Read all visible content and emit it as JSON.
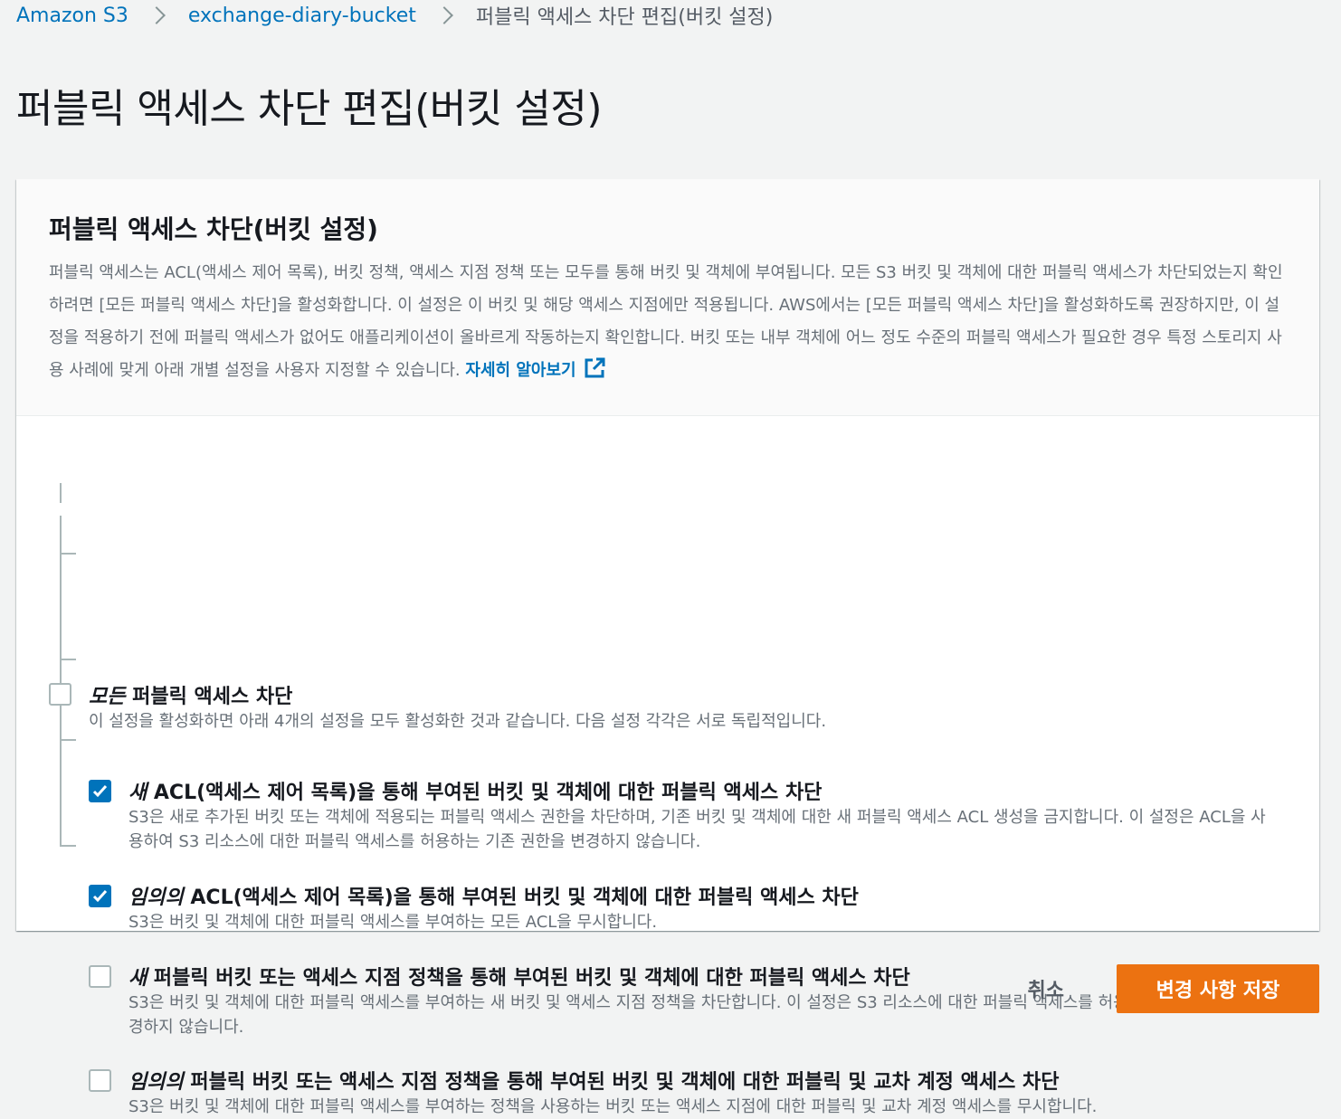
{
  "breadcrumb": {
    "items": [
      "Amazon S3",
      "exchange-diary-bucket"
    ],
    "current": "퍼블릭 액세스 차단 편집(버킷 설정)"
  },
  "page_title": "퍼블릭 액세스 차단 편집(버킷 설정)",
  "panel": {
    "title": "퍼블릭 액세스 차단(버킷 설정)",
    "description": "퍼블릭 액세스는 ACL(액세스 제어 목록), 버킷 정책, 액세스 지점 정책 또는 모두를 통해 버킷 및 객체에 부여됩니다. 모든 S3 버킷 및 객체에 대한 퍼블릭 액세스가 차단되었는지 확인하려면 [모든 퍼블릭 액세스 차단]을 활성화합니다. 이 설정은 이 버킷 및 해당 액세스 지점에만 적용됩니다. AWS에서는 [모든 퍼블릭 액세스 차단]을 활성화하도록 권장하지만, 이 설정을 적용하기 전에 퍼블릭 액세스가 없어도 애플리케이션이 올바르게 작동하는지 확인합니다. 버킷 또는 내부 객체에 어느 정도 수준의 퍼블릭 액세스가 필요한 경우 특정 스토리지 사용 사례에 맞게 아래 개별 설정을 사용자 지정할 수 있습니다.",
    "learn_more": "자세히 알아보기",
    "learn_more_icon": "external-link-icon"
  },
  "options": {
    "all": {
      "emph": "모든",
      "label": " 퍼블릭 액세스 차단",
      "desc": "이 설정을 활성화하면 아래 4개의 설정을 모두 활성화한 것과 같습니다. 다음 설정 각각은 서로 독립적입니다.",
      "checked": false
    },
    "new_acl": {
      "emph": "새",
      "label": " ACL(액세스 제어 목록)을 통해 부여된 버킷 및 객체에 대한 퍼블릭 액세스 차단",
      "desc": "S3은 새로 추가된 버킷 또는 객체에 적용되는 퍼블릭 액세스 권한을 차단하며, 기존 버킷 및 객체에 대한 새 퍼블릭 액세스 ACL 생성을 금지합니다. 이 설정은 ACL을 사용하여 S3 리소스에 대한 퍼블릭 액세스를 허용하는 기존 권한을 변경하지 않습니다.",
      "checked": true
    },
    "any_acl": {
      "emph": "임의의",
      "label": " ACL(액세스 제어 목록)을 통해 부여된 버킷 및 객체에 대한 퍼블릭 액세스 차단",
      "desc": "S3은 버킷 및 객체에 대한 퍼블릭 액세스를 부여하는 모든 ACL을 무시합니다.",
      "checked": true
    },
    "new_policy": {
      "emph": "새",
      "label": " 퍼블릭 버킷 또는 액세스 지점 정책을 통해 부여된 버킷 및 객체에 대한 퍼블릭 액세스 차단",
      "desc": "S3은 버킷 및 객체에 대한 퍼블릭 액세스를 부여하는 새 버킷 및 액세스 지점 정책을 차단합니다. 이 설정은 S3 리소스에 대한 퍼블릭 액세스를 허용하는 기존 정책을 변경하지 않습니다.",
      "checked": false
    },
    "any_policy": {
      "emph": "임의의",
      "label": " 퍼블릭 버킷 또는 액세스 지점 정책을 통해 부여된 버킷 및 객체에 대한 퍼블릭 및 교차 계정 액세스 차단",
      "desc": "S3은 버킷 및 객체에 대한 퍼블릭 액세스를 부여하는 정책을 사용하는 버킷 또는 액세스 지점에 대한 퍼블릭 및 교차 계정 액세스를 무시합니다.",
      "checked": false
    }
  },
  "footer": {
    "cancel_label": "취소",
    "save_label": "변경 사항 저장"
  },
  "colors": {
    "link": "#0073bb",
    "checkbox_checked": "#0073bb",
    "primary_button": "#ec7211"
  }
}
